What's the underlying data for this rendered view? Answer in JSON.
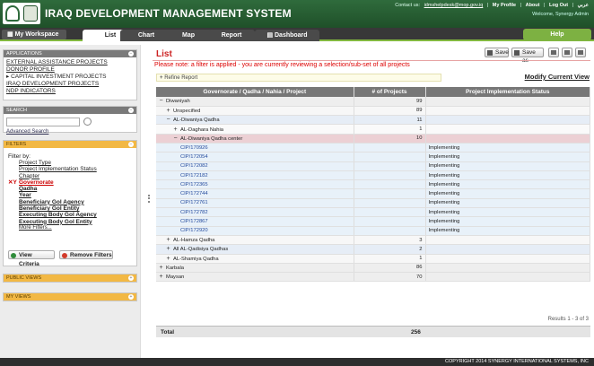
{
  "header": {
    "title": "IRAQ DEVELOPMENT MANAGEMENT SYSTEM",
    "contact_label": "Contact us:",
    "contact_email": "idmshelpdesk@mop.gov.iq",
    "links": [
      "My Profile",
      "About",
      "Log Out",
      "عربي"
    ],
    "welcome": "Welcome, Synergy Admin"
  },
  "nav": {
    "workspace": "My Workspace",
    "tabs": [
      "List",
      "Chart",
      "Map",
      "Report",
      "Dashboard"
    ],
    "active_tab": "List",
    "help": "Help"
  },
  "sidebar": {
    "applications_title": "APPLICATIONS",
    "applications": [
      "EXTERNAL ASSISTANCE PROJECTS",
      "DONOR PROFILE",
      "CAPITAL INVESTMENT PROJECTS",
      "IRAQ DEVELOPMENT PROJECTS",
      "NDP INDICATORS"
    ],
    "current_application": "CAPITAL INVESTMENT PROJECTS",
    "search_title": "SEARCH",
    "advanced_search": "Advanced Search",
    "filters_title": "FILTERS",
    "filter_by": "Filter by:",
    "filters": [
      "Project Type",
      "Project Implementation Status",
      "Chapter",
      "Governorate",
      "Qadha",
      "Year",
      "Beneficiary GoI Agency",
      "Beneficiary GoI Entity",
      "Executing Body GoI Agency",
      "Executing Body GoI Entity",
      "More Filters..."
    ],
    "active_filter": "Governorate",
    "view_criteria": "View Criteria",
    "remove_filters": "Remove Filters",
    "public_views": "PUBLIC VIEWS",
    "my_views": "MY VIEWS"
  },
  "main": {
    "title": "List",
    "save": "Save",
    "save_as": "Save as",
    "notice": "Please note: a filter is applied - you are currently reviewing a selection/sub-set of all projects",
    "refine": "Refine Report",
    "modify_view": "Modify Current View",
    "columns": [
      "Governorate / Qadha / Nahia / Project",
      "# of Projects",
      "Project Implementation Status"
    ],
    "rows": [
      {
        "exp": "−",
        "name": "Diwaniyah",
        "count": "99",
        "status": "",
        "cls": "lvl0",
        "indent": 0
      },
      {
        "exp": "+",
        "name": "Unspecified",
        "count": "89",
        "status": "",
        "cls": "lvl1",
        "indent": 1
      },
      {
        "exp": "−",
        "name": "AL-Diwaniya Qadha",
        "count": "11",
        "status": "",
        "cls": "lvl2",
        "indent": 1
      },
      {
        "exp": "+",
        "name": "AL-Daghara Nahia",
        "count": "1",
        "status": "",
        "cls": "lvl3",
        "indent": 2
      },
      {
        "exp": "−",
        "name": "AL-Diwaniya Qadha center",
        "count": "10",
        "status": "",
        "cls": "lvl3hl",
        "indent": 2
      },
      {
        "exp": "",
        "name": "CIP/170926",
        "count": "",
        "status": "Implementing",
        "cls": "proj",
        "indent": 3
      },
      {
        "exp": "",
        "name": "CIP/172054",
        "count": "",
        "status": "Implementing",
        "cls": "proj",
        "indent": 3
      },
      {
        "exp": "",
        "name": "CIP/172082",
        "count": "",
        "status": "Implementing",
        "cls": "proj",
        "indent": 3
      },
      {
        "exp": "",
        "name": "CIP/172182",
        "count": "",
        "status": "Implementing",
        "cls": "proj",
        "indent": 3
      },
      {
        "exp": "",
        "name": "CIP/172365",
        "count": "",
        "status": "Implementing",
        "cls": "proj",
        "indent": 3
      },
      {
        "exp": "",
        "name": "CIP/172744",
        "count": "",
        "status": "Implementing",
        "cls": "proj",
        "indent": 3
      },
      {
        "exp": "",
        "name": "CIP/172761",
        "count": "",
        "status": "Implementing",
        "cls": "proj",
        "indent": 3
      },
      {
        "exp": "",
        "name": "CIP/172782",
        "count": "",
        "status": "Implementing",
        "cls": "proj",
        "indent": 3
      },
      {
        "exp": "",
        "name": "CIP/172867",
        "count": "",
        "status": "Implementing",
        "cls": "proj",
        "indent": 3
      },
      {
        "exp": "",
        "name": "CIP/172920",
        "count": "",
        "status": "Implementing",
        "cls": "proj",
        "indent": 3
      },
      {
        "exp": "+",
        "name": "AL-Hamza Qadha",
        "count": "3",
        "status": "",
        "cls": "lvl1",
        "indent": 1
      },
      {
        "exp": "+",
        "name": "All AL-Qadisiya Qadhas",
        "count": "2",
        "status": "",
        "cls": "lvl2",
        "indent": 1
      },
      {
        "exp": "+",
        "name": "AL-Shamiya Qadha",
        "count": "1",
        "status": "",
        "cls": "lvl1",
        "indent": 1
      },
      {
        "exp": "+",
        "name": "Karbala",
        "count": "86",
        "status": "",
        "cls": "lvl0",
        "indent": 0
      },
      {
        "exp": "+",
        "name": "Maysan",
        "count": "70",
        "status": "",
        "cls": "lvl0",
        "indent": 0
      }
    ],
    "results": "Results 1 - 3 of 3",
    "total_label": "Total",
    "total_value": "256"
  },
  "footer": "COPYRIGHT 2014 SYNERGY INTERNATIONAL SYSTEMS, INC"
}
